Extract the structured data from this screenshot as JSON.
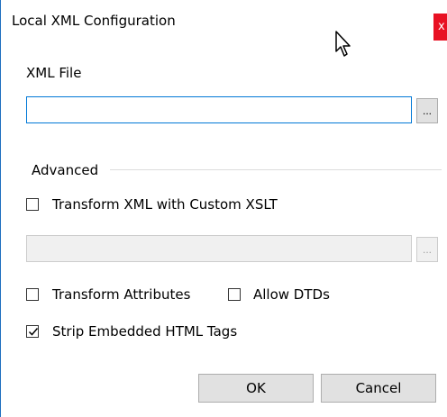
{
  "window": {
    "title": "Local XML Configuration",
    "close_label": "x"
  },
  "xml_file": {
    "label": "XML File",
    "value": "",
    "browse_label": "..."
  },
  "advanced": {
    "label": "Advanced",
    "transform_xml": {
      "label": "Transform XML with Custom XSLT",
      "checked": false
    },
    "xslt_path": {
      "value": "",
      "browse_label": "..."
    },
    "transform_attributes": {
      "label": "Transform Attributes",
      "checked": false
    },
    "allow_dtds": {
      "label": "Allow DTDs",
      "checked": false
    },
    "strip_html": {
      "label": "Strip Embedded HTML Tags",
      "checked": true
    }
  },
  "buttons": {
    "ok": "OK",
    "cancel": "Cancel"
  },
  "colors": {
    "accent": "#0078d7",
    "close_red": "#e81123",
    "button_bg": "#e1e1e1",
    "disabled_bg": "#f0f0f0"
  }
}
